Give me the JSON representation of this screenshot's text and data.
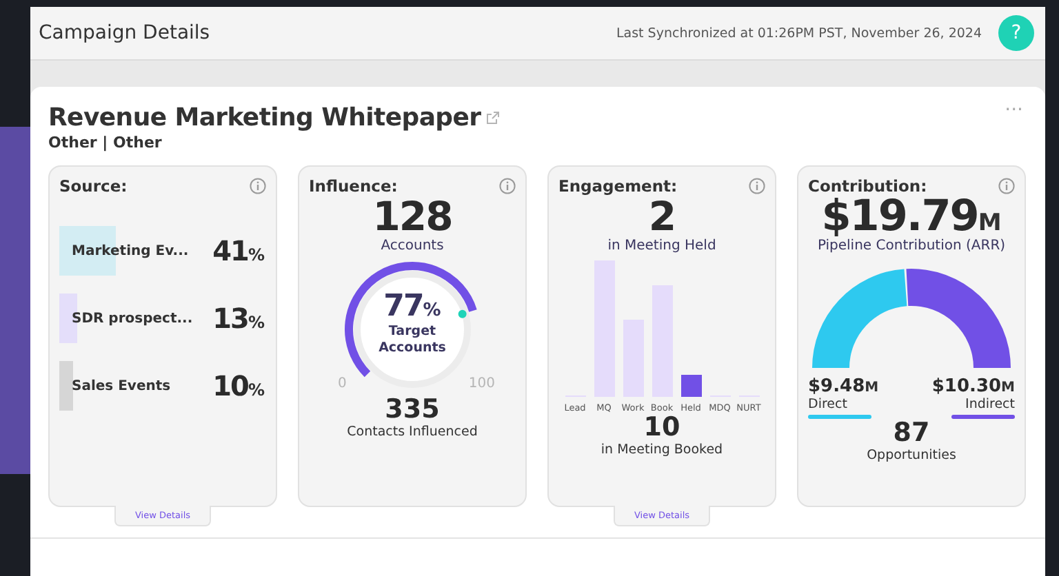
{
  "header": {
    "title": "Campaign Details",
    "sync_text": "Last Synchronized at 01:26PM PST, November 26, 2024",
    "help_label": "?"
  },
  "campaign": {
    "title": "Revenue Marketing Whitepaper",
    "subtitle": "Other | Other",
    "menu_label": "···"
  },
  "source": {
    "title": "Source:",
    "rows": [
      {
        "label": "Marketing Ev...",
        "value": "41",
        "unit": "%",
        "color": "#d3edf3"
      },
      {
        "label": "SDR prospect...",
        "value": "13",
        "unit": "%",
        "color": "#e4defa"
      },
      {
        "label": "Sales Events",
        "value": "10",
        "unit": "%",
        "color": "#d6d6d6"
      }
    ],
    "details_label": "View Details"
  },
  "influence": {
    "title": "Influence:",
    "count": "128",
    "count_label": "Accounts",
    "gauge": {
      "value": "77",
      "unit": "%",
      "label": "Target Accounts",
      "min": "0",
      "max": "100"
    },
    "contacts": "335",
    "contacts_label": "Contacts Influenced"
  },
  "engagement": {
    "title": "Engagement:",
    "count": "2",
    "count_label": "in Meeting Held",
    "stages": [
      {
        "label": "Lead",
        "selected": false
      },
      {
        "label": "MQ",
        "selected": false
      },
      {
        "label": "Work",
        "selected": false
      },
      {
        "label": "Book",
        "selected": false
      },
      {
        "label": "Held",
        "selected": true
      },
      {
        "label": "MDQ",
        "selected": false
      },
      {
        "label": "NURT",
        "selected": false
      }
    ],
    "booked": "10",
    "booked_label": "in Meeting Booked",
    "details_label": "View Details"
  },
  "contribution": {
    "title": "Contribution:",
    "amount": "$19.79",
    "amount_unit": "M",
    "amount_label": "Pipeline Contribution (ARR)",
    "parts": [
      {
        "value": "$9.48",
        "unit": "M",
        "label": "Direct",
        "color": "#2ec9ef"
      },
      {
        "value": "$10.30",
        "unit": "M",
        "label": "Indirect",
        "color": "#7150e6"
      }
    ],
    "opportunities": "87",
    "opportunities_label": "Opportunities"
  }
}
